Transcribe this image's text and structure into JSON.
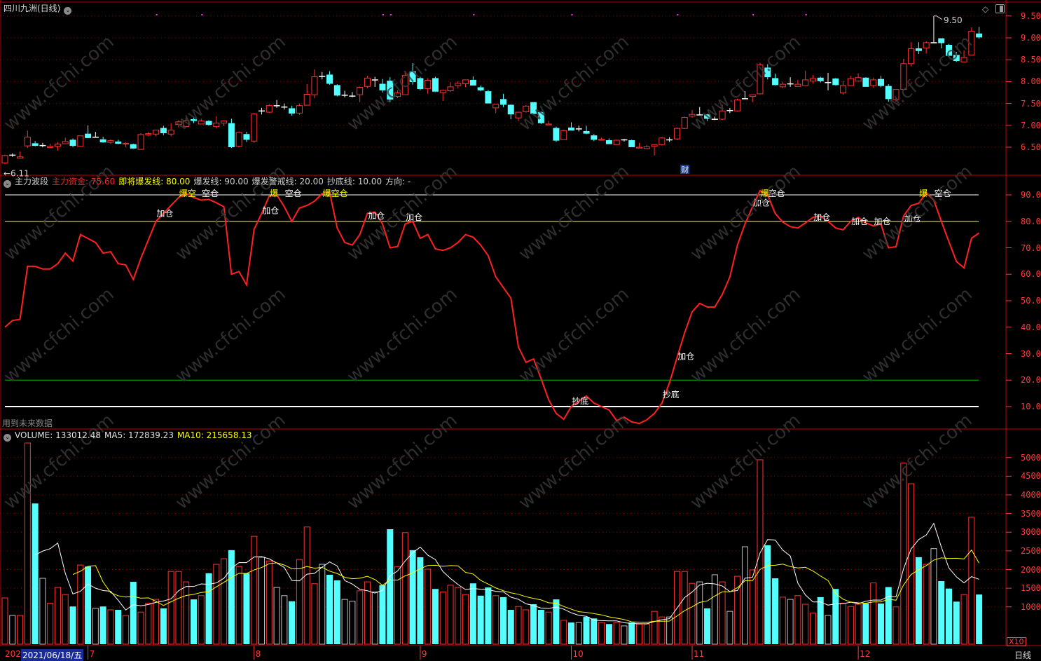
{
  "window": {
    "title": "四川九洲(日线)",
    "period_label": "日线",
    "volume_multiplier": "X10",
    "watermark": "www.cfchi.com"
  },
  "colors": {
    "up": "#ff3232",
    "down": "#54ffff",
    "flat": "#ffffff",
    "grid": "#8b0000",
    "axis": "#ff3b3b",
    "ma5": "#ffffff",
    "ma10": "#ffff00",
    "line_90": "#ffffff",
    "line_80": "#ffff00",
    "line_20": "#00c000",
    "line_10": "#ffffff",
    "indicator": "#ff2020"
  },
  "price_panel": {
    "axis_ticks": [
      "6.50",
      "7.00",
      "7.50",
      "8.00",
      "8.50",
      "9.00",
      "9.50"
    ],
    "min_label": "6.11",
    "max_label": "9.50",
    "badge": "财",
    "badge_index": 90,
    "marker_indices": [
      20,
      26,
      50,
      51,
      62,
      75,
      89,
      99,
      106
    ]
  },
  "indicator_panel": {
    "name": "主力波段",
    "items": [
      {
        "label": "主力资金: 75.60",
        "color": "#ff2020"
      },
      {
        "label": "即将爆发线: 80.00",
        "color": "#ffff00"
      },
      {
        "label": "爆发线: 90.00",
        "color": "#d0d0d0"
      },
      {
        "label": "爆发警戒线: 20.00",
        "color": "#d0d0d0"
      },
      {
        "label": "抄底线: 10.00",
        "color": "#d0d0d0"
      },
      {
        "label": "方向: -",
        "color": "#d0d0d0"
      }
    ],
    "footnote": "用到未来数据",
    "axis_ticks": [
      "10.00",
      "20.00",
      "30.00",
      "40.00",
      "50.00",
      "60.00",
      "70.00",
      "80.00",
      "90.00"
    ],
    "levels": [
      90,
      80,
      20,
      10
    ]
  },
  "volume_panel": {
    "volume_label": "VOLUME: 133012.48",
    "ma5_label": "MA5: 172839.23",
    "ma10_label": "MA10: 215658.13",
    "axis_ticks": [
      "10000",
      "15000",
      "20000",
      "25000",
      "30000",
      "35000",
      "40000",
      "45000",
      "50000"
    ]
  },
  "date_axis": {
    "first": "202",
    "selected": "2021/06/18/五",
    "months": [
      {
        "label": "7",
        "index": 11
      },
      {
        "label": "8",
        "index": 33
      },
      {
        "label": "9",
        "index": 55
      },
      {
        "label": "10",
        "index": 75
      },
      {
        "label": "11",
        "index": 91
      },
      {
        "label": "12",
        "index": 113
      }
    ]
  },
  "chart_data": {
    "type": "candlestick",
    "ohlc_order": "open,high,low,close",
    "candles": [
      [
        6.14,
        6.33,
        6.11,
        6.31
      ],
      [
        6.33,
        6.36,
        6.28,
        6.33
      ],
      [
        6.25,
        6.4,
        6.24,
        6.28
      ],
      [
        6.53,
        6.88,
        6.48,
        6.73
      ],
      [
        6.59,
        6.64,
        6.52,
        6.53
      ],
      [
        6.55,
        6.6,
        6.5,
        6.55
      ],
      [
        6.49,
        6.58,
        6.48,
        6.52
      ],
      [
        6.52,
        6.62,
        6.42,
        6.57
      ],
      [
        6.58,
        6.72,
        6.57,
        6.63
      ],
      [
        6.67,
        6.7,
        6.5,
        6.53
      ],
      [
        6.52,
        6.76,
        6.52,
        6.76
      ],
      [
        6.81,
        7.0,
        6.71,
        6.71
      ],
      [
        6.74,
        6.85,
        6.73,
        6.74
      ],
      [
        6.68,
        6.74,
        6.6,
        6.61
      ],
      [
        6.61,
        6.68,
        6.57,
        6.65
      ],
      [
        6.63,
        6.67,
        6.57,
        6.58
      ],
      [
        6.57,
        6.61,
        6.5,
        6.59
      ],
      [
        6.57,
        6.58,
        6.46,
        6.47
      ],
      [
        6.45,
        6.82,
        6.45,
        6.79
      ],
      [
        6.78,
        6.85,
        6.75,
        6.81
      ],
      [
        6.8,
        6.9,
        6.75,
        6.89
      ],
      [
        6.94,
        6.99,
        6.78,
        6.82
      ],
      [
        6.8,
        7.05,
        6.75,
        6.89
      ],
      [
        7.02,
        7.12,
        6.95,
        7.08
      ],
      [
        6.97,
        7.18,
        6.95,
        7.11
      ],
      [
        7.14,
        7.18,
        7.05,
        7.1
      ],
      [
        7.03,
        7.15,
        7.03,
        7.1
      ],
      [
        7.1,
        7.12,
        6.99,
        7.01
      ],
      [
        6.97,
        7.21,
        6.93,
        7.05
      ],
      [
        7.05,
        7.1,
        6.98,
        7.1
      ],
      [
        7.05,
        7.15,
        6.48,
        6.5
      ],
      [
        6.52,
        6.86,
        6.5,
        6.84
      ],
      [
        6.8,
        6.85,
        6.62,
        6.67
      ],
      [
        6.64,
        7.28,
        6.6,
        7.26
      ],
      [
        7.34,
        7.4,
        7.25,
        7.34
      ],
      [
        7.3,
        7.48,
        7.28,
        7.45
      ],
      [
        7.46,
        7.58,
        7.4,
        7.46
      ],
      [
        7.43,
        7.5,
        7.36,
        7.43
      ],
      [
        7.39,
        7.45,
        7.22,
        7.27
      ],
      [
        7.28,
        7.5,
        7.24,
        7.45
      ],
      [
        7.46,
        7.94,
        7.46,
        7.71
      ],
      [
        7.7,
        8.28,
        7.62,
        8.11
      ],
      [
        8.13,
        8.22,
        8.05,
        8.13
      ],
      [
        8.16,
        8.24,
        7.93,
        7.95
      ],
      [
        7.92,
        7.94,
        7.66,
        7.68
      ],
      [
        7.7,
        7.79,
        7.64,
        7.7
      ],
      [
        7.68,
        7.76,
        7.64,
        7.68
      ],
      [
        7.7,
        7.89,
        7.53,
        7.87
      ],
      [
        7.89,
        8.13,
        7.85,
        8.08
      ],
      [
        8.05,
        8.11,
        7.88,
        8.05
      ],
      [
        7.95,
        8.06,
        7.75,
        7.8
      ],
      [
        8.02,
        8.1,
        7.53,
        7.59
      ],
      [
        7.66,
        7.8,
        7.62,
        7.74
      ],
      [
        7.7,
        8.24,
        7.7,
        8.14
      ],
      [
        8.24,
        8.42,
        7.93,
        7.99
      ],
      [
        8.08,
        8.11,
        7.8,
        7.83
      ],
      [
        7.84,
        8.08,
        7.72,
        8.03
      ],
      [
        8.08,
        8.11,
        7.76,
        7.77
      ],
      [
        7.75,
        7.82,
        7.56,
        7.8
      ],
      [
        7.79,
        7.99,
        7.76,
        7.88
      ],
      [
        7.91,
        8.01,
        7.84,
        7.96
      ],
      [
        7.95,
        8.04,
        7.87,
        8.04
      ],
      [
        8.04,
        8.12,
        7.96,
        7.91
      ],
      [
        7.87,
        7.91,
        7.78,
        7.8
      ],
      [
        7.78,
        7.81,
        7.5,
        7.5
      ],
      [
        7.4,
        7.48,
        7.28,
        7.48
      ],
      [
        7.6,
        7.72,
        7.42,
        7.47
      ],
      [
        7.47,
        7.48,
        7.14,
        7.25
      ],
      [
        7.17,
        7.3,
        7.1,
        7.3
      ],
      [
        7.31,
        7.46,
        7.29,
        7.44
      ],
      [
        7.53,
        7.53,
        7.26,
        7.26
      ],
      [
        7.3,
        7.32,
        7.03,
        7.05
      ],
      [
        7.01,
        7.1,
        7.01,
        7.03
      ],
      [
        6.94,
        6.97,
        6.62,
        6.65
      ],
      [
        6.67,
        6.9,
        6.67,
        6.88
      ],
      [
        6.95,
        7.07,
        6.88,
        6.88
      ],
      [
        6.93,
        6.99,
        6.86,
        6.93
      ],
      [
        6.87,
        6.99,
        6.8,
        6.81
      ],
      [
        6.77,
        6.8,
        6.64,
        6.67
      ],
      [
        6.66,
        6.72,
        6.66,
        6.68
      ],
      [
        6.66,
        6.7,
        6.57,
        6.57
      ],
      [
        6.56,
        6.67,
        6.55,
        6.66
      ],
      [
        6.68,
        6.69,
        6.63,
        6.68
      ],
      [
        6.66,
        6.67,
        6.5,
        6.5
      ],
      [
        6.48,
        6.6,
        6.48,
        6.5
      ],
      [
        6.47,
        6.55,
        6.47,
        6.51
      ],
      [
        6.52,
        6.55,
        6.31,
        6.56
      ],
      [
        6.56,
        6.73,
        6.54,
        6.71
      ],
      [
        6.68,
        6.73,
        6.62,
        6.68
      ],
      [
        6.69,
        6.95,
        6.66,
        6.93
      ],
      [
        6.93,
        7.2,
        6.92,
        7.18
      ],
      [
        7.21,
        7.35,
        7.17,
        7.25
      ],
      [
        7.25,
        7.42,
        7.24,
        7.25
      ],
      [
        7.25,
        7.26,
        7.1,
        7.15
      ],
      [
        7.15,
        7.2,
        7.12,
        7.15
      ],
      [
        7.14,
        7.47,
        7.12,
        7.33
      ],
      [
        7.35,
        7.4,
        7.28,
        7.35
      ],
      [
        7.33,
        7.61,
        7.31,
        7.58
      ],
      [
        7.62,
        7.78,
        7.62,
        7.62
      ],
      [
        7.66,
        7.7,
        7.53,
        7.7
      ],
      [
        7.72,
        8.43,
        7.71,
        8.38
      ],
      [
        8.32,
        8.4,
        8.05,
        8.1
      ],
      [
        8.08,
        8.18,
        7.91,
        7.92
      ],
      [
        7.88,
        8.0,
        7.85,
        7.94
      ],
      [
        7.96,
        8.1,
        7.88,
        7.96
      ],
      [
        7.89,
        8.04,
        7.89,
        7.94
      ],
      [
        7.91,
        8.25,
        7.91,
        8.04
      ],
      [
        8.01,
        8.15,
        7.96,
        8.07
      ],
      [
        8.09,
        8.11,
        7.98,
        8.01
      ],
      [
        7.99,
        8.2,
        7.8,
        7.99
      ],
      [
        8.07,
        8.08,
        7.91,
        7.92
      ],
      [
        7.74,
        8.02,
        7.7,
        7.91
      ],
      [
        7.91,
        8.13,
        7.91,
        8.07
      ],
      [
        8.01,
        8.19,
        8.01,
        8.09
      ],
      [
        8.09,
        8.1,
        7.88,
        7.88
      ],
      [
        7.91,
        8.09,
        7.86,
        8.04
      ],
      [
        8.06,
        8.13,
        7.87,
        7.9
      ],
      [
        7.9,
        7.94,
        7.54,
        7.6
      ],
      [
        7.59,
        7.82,
        7.54,
        7.82
      ],
      [
        7.82,
        8.52,
        7.8,
        8.41
      ],
      [
        8.41,
        8.9,
        8.35,
        8.75
      ],
      [
        8.76,
        8.9,
        8.63,
        8.7
      ],
      [
        8.77,
        8.92,
        8.64,
        8.89
      ],
      [
        8.9,
        9.5,
        8.88,
        8.9
      ],
      [
        8.99,
        8.99,
        8.76,
        8.88
      ],
      [
        8.84,
        8.86,
        8.57,
        8.59
      ],
      [
        8.61,
        8.68,
        8.45,
        8.47
      ],
      [
        8.45,
        8.71,
        8.45,
        8.55
      ],
      [
        8.61,
        9.24,
        8.61,
        9.15
      ],
      [
        9.1,
        9.25,
        8.98,
        9.01
      ]
    ],
    "price_range": [
      6.1,
      9.6
    ],
    "indicator": [
      40,
      42.5,
      43,
      63,
      63,
      62,
      62,
      64,
      68,
      65,
      75,
      73.5,
      72,
      68,
      68.5,
      64,
      63.5,
      58,
      66,
      73,
      80,
      83,
      86,
      89,
      90.5,
      89,
      88,
      88.3,
      87,
      85.5,
      60,
      61,
      56,
      77,
      83,
      89.5,
      90,
      85.5,
      80,
      85,
      86,
      87.6,
      90.5,
      91,
      77.5,
      72,
      71,
      75,
      83,
      83.5,
      79,
      70,
      70.5,
      79,
      80,
      73.6,
      75,
      69.6,
      69,
      70,
      72,
      75,
      74,
      71,
      67,
      59,
      55,
      51,
      32.5,
      26.7,
      28,
      20.5,
      12.6,
      7.4,
      5.2,
      10,
      12,
      14,
      11.3,
      10,
      8.7,
      4.7,
      6,
      4.2,
      3.6,
      5,
      7.4,
      11.3,
      19,
      28.5,
      37.8,
      45.8,
      49,
      47.6,
      47.6,
      52.4,
      59,
      71,
      79,
      85.5,
      91.6,
      90,
      83,
      79.7,
      78,
      77.5,
      79.4,
      81.5,
      82,
      80,
      77.5,
      76.8,
      80,
      81.5,
      79.4,
      78.3,
      79,
      70,
      70.4,
      82,
      86,
      86.8,
      90.8,
      88,
      80,
      72.3,
      64.8,
      62.4,
      73.6,
      75.6
    ],
    "indicator_range": [
      0,
      100
    ],
    "signals": [
      {
        "index": 21,
        "text": "加仓",
        "color": "#ffffff",
        "level": 83
      },
      {
        "index": 24,
        "text": "爆空",
        "color": "#ffff00",
        "level": 90.5
      },
      {
        "index": 27,
        "text": "空仓",
        "color": "#ffffff",
        "level": 90.5
      },
      {
        "index": 35,
        "text": "加仓",
        "color": "#ffffff",
        "level": 84
      },
      {
        "index": 36,
        "text": "爆",
        "color": "#ffff00",
        "level": 90.5
      },
      {
        "index": 38,
        "text": "空仓",
        "color": "#ffffff",
        "level": 90.5
      },
      {
        "index": 43,
        "text": "爆空仓",
        "color": "#ffff00",
        "level": 90.5
      },
      {
        "index": 49,
        "text": "加仓",
        "color": "#ffffff",
        "level": 82
      },
      {
        "index": 54,
        "text": "加仓",
        "color": "#ffffff",
        "level": 81.5
      },
      {
        "index": 76,
        "text": "抄底",
        "color": "#ffffff",
        "level": 12
      },
      {
        "index": 88,
        "text": "抄底",
        "color": "#ffffff",
        "level": 14.5
      },
      {
        "index": 90,
        "text": "加仓",
        "color": "#ffffff",
        "level": 29
      },
      {
        "index": 100,
        "text": "加仓",
        "color": "#ffffff",
        "level": 87
      },
      {
        "index": 101,
        "text": "爆",
        "color": "#ffff00",
        "level": 90.5
      },
      {
        "index": 102,
        "text": "空仓",
        "color": "#ffffff",
        "level": 90.5
      },
      {
        "index": 108,
        "text": "加仓",
        "color": "#ffffff",
        "level": 81.5
      },
      {
        "index": 113,
        "text": "加仓",
        "color": "#ffffff",
        "level": 80
      },
      {
        "index": 116,
        "text": "加仓",
        "color": "#ffffff",
        "level": 80
      },
      {
        "index": 120,
        "text": "加仓",
        "color": "#ffffff",
        "level": 81
      },
      {
        "index": 122,
        "text": "爆",
        "color": "#ffff00",
        "level": 90.5
      },
      {
        "index": 124,
        "text": "空仓",
        "color": "#ffffff",
        "level": 90.5
      }
    ],
    "volume": [
      12400,
      7700,
      7700,
      53900,
      37700,
      17650,
      11000,
      15200,
      13300,
      10100,
      21200,
      20800,
      9600,
      10100,
      9200,
      9200,
      7700,
      16700,
      8600,
      11000,
      12000,
      9600,
      19500,
      19500,
      16700,
      12000,
      13000,
      19000,
      21400,
      22900,
      25200,
      20800,
      19000,
      28900,
      23300,
      22300,
      15200,
      13000,
      11500,
      22700,
      31400,
      16200,
      21400,
      18600,
      17100,
      12000,
      11500,
      14300,
      16700,
      14000,
      15800,
      30800,
      20800,
      29900,
      25200,
      23300,
      20100,
      14800,
      14000,
      15800,
      15200,
      13300,
      16300,
      13000,
      15200,
      13000,
      12600,
      9200,
      10100,
      9200,
      10700,
      9200,
      8600,
      12000,
      6400,
      5800,
      5800,
      7300,
      6900,
      5800,
      5400,
      5800,
      4900,
      5800,
      5400,
      5400,
      8800,
      7300,
      7300,
      19500,
      19500,
      16300,
      16700,
      9600,
      18600,
      16700,
      8800,
      18200,
      26100,
      19900,
      49400,
      26500,
      17650,
      12600,
      12000,
      13000,
      10700,
      8300,
      12600,
      7700,
      14800,
      11000,
      10100,
      10700,
      10900,
      16400,
      10900,
      15300,
      10000,
      48500,
      43000,
      23300,
      21400,
      25600,
      16900,
      14900,
      11400,
      13300,
      34000,
      13301
    ],
    "volume_range": [
      0,
      55000
    ],
    "moving_averages": [
      5,
      10
    ],
    "grid": true
  }
}
